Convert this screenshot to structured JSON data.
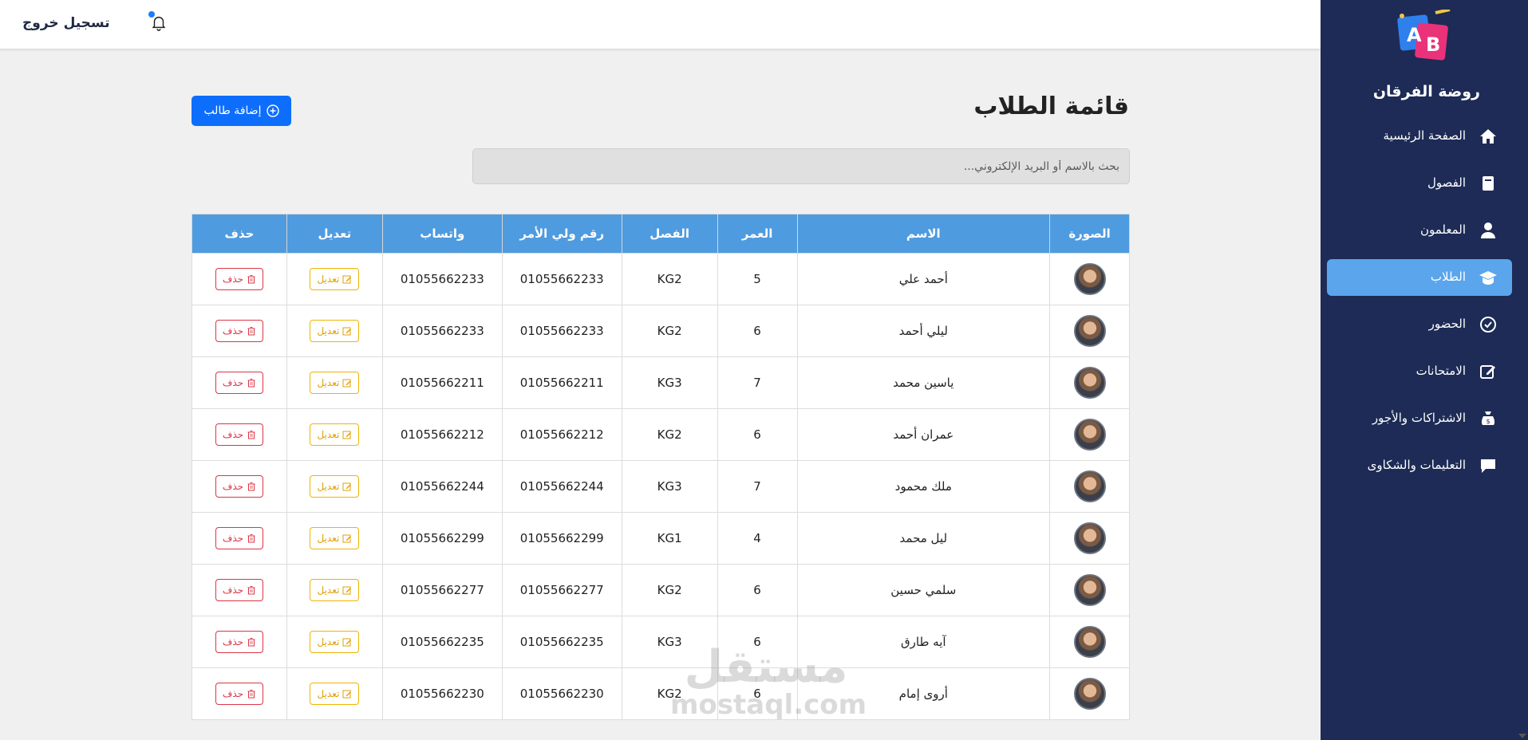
{
  "header": {
    "logout_label": "تسجيل خروج"
  },
  "sidebar": {
    "brand": "روضة الفرقان",
    "logo_letters": [
      "A",
      "B"
    ],
    "items": [
      {
        "label": "الصفحة الرئيسية",
        "icon": "home-icon",
        "active": false
      },
      {
        "label": "الفصول",
        "icon": "book-icon",
        "active": false
      },
      {
        "label": "المعلمون",
        "icon": "teacher-icon",
        "active": false
      },
      {
        "label": "الطلاب",
        "icon": "graduation-cap-icon",
        "active": true
      },
      {
        "label": "الحضور",
        "icon": "check-circle-icon",
        "active": false
      },
      {
        "label": "الامتحانات",
        "icon": "edit-icon",
        "active": false
      },
      {
        "label": "الاشتراكات والأجور",
        "icon": "money-bag-icon",
        "active": false
      },
      {
        "label": "التعليمات والشكاوى",
        "icon": "comment-icon",
        "active": false
      }
    ]
  },
  "main": {
    "title": "قائمة الطلاب",
    "add_button_label": "إضافة طالب",
    "search_placeholder": "بحث بالاسم أو البريد الإلكتروني...",
    "table": {
      "headers": [
        "الصورة",
        "الاسم",
        "العمر",
        "الفصل",
        "رقم ولي الأمر",
        "واتساب",
        "تعديل",
        "حذف"
      ],
      "edit_label": "تعديل",
      "delete_label": "حذف",
      "rows": [
        {
          "name": "أحمد علي",
          "age": "5",
          "class": "KG2",
          "parent_phone": "01055662233",
          "whatsapp": "01055662233"
        },
        {
          "name": "ليلي أحمد",
          "age": "6",
          "class": "KG2",
          "parent_phone": "01055662233",
          "whatsapp": "01055662233"
        },
        {
          "name": "ياسين محمد",
          "age": "7",
          "class": "KG3",
          "parent_phone": "01055662211",
          "whatsapp": "01055662211"
        },
        {
          "name": "عمران أحمد",
          "age": "6",
          "class": "KG2",
          "parent_phone": "01055662212",
          "whatsapp": "01055662212"
        },
        {
          "name": "ملك محمود",
          "age": "7",
          "class": "KG3",
          "parent_phone": "01055662244",
          "whatsapp": "01055662244"
        },
        {
          "name": "ليل محمد",
          "age": "4",
          "class": "KG1",
          "parent_phone": "01055662299",
          "whatsapp": "01055662299"
        },
        {
          "name": "سلمي حسين",
          "age": "6",
          "class": "KG2",
          "parent_phone": "01055662277",
          "whatsapp": "01055662277"
        },
        {
          "name": "آيه طارق",
          "age": "6",
          "class": "KG3",
          "parent_phone": "01055662235",
          "whatsapp": "01055662235"
        },
        {
          "name": "أروى إمام",
          "age": "6",
          "class": "KG2",
          "parent_phone": "01055662230",
          "whatsapp": "01055662230"
        }
      ]
    }
  },
  "watermark": {
    "arabic": "مستقل",
    "latin": "mostaql.com"
  },
  "colors": {
    "sidebar_bg": "#1d2b56",
    "active_item": "#5aa5ec",
    "table_header": "#4e9be0",
    "primary_button": "#0d6efd",
    "edit_border": "#f0b400",
    "delete_border": "#dc3545"
  }
}
